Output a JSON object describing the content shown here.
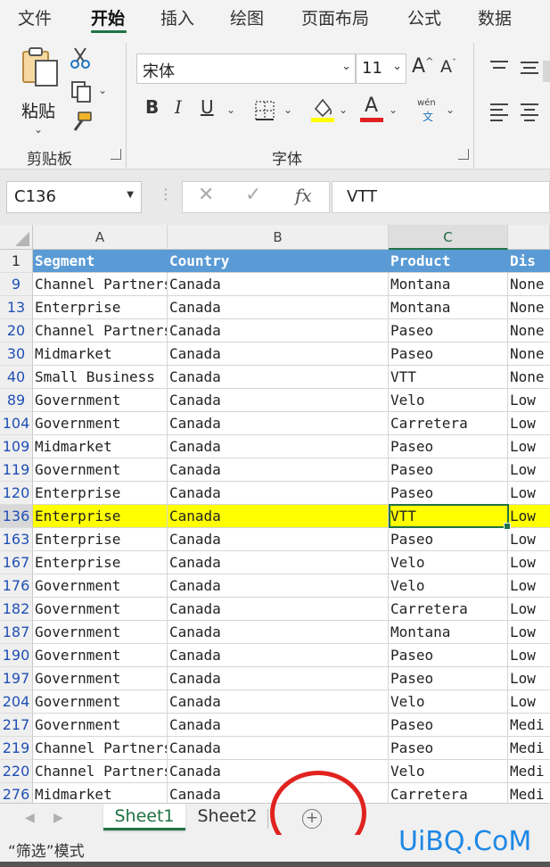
{
  "ribbon_tabs": [
    "文件",
    "开始",
    "插入",
    "绘图",
    "页面布局",
    "公式",
    "数据"
  ],
  "active_tab": "开始",
  "clipboard": {
    "paste_label": "粘贴",
    "group_label": "剪贴板"
  },
  "font": {
    "name": "宋体",
    "size": "11",
    "group_label": "字体",
    "phonetic_top": "wén",
    "phonetic_bottom": "文"
  },
  "font_colors": {
    "highlight": "#ffff00",
    "text": "#e02020"
  },
  "formula_bar": {
    "name_box": "C136",
    "fx": "fx",
    "content": "VTT"
  },
  "columns": [
    "A",
    "B",
    "C"
  ],
  "header_row": {
    "num": "1",
    "cells": [
      "Segment",
      "Country",
      "Product",
      "Dis"
    ]
  },
  "rows": [
    {
      "num": "9",
      "cells": [
        "Channel Partners",
        "Canada",
        "Montana",
        "None"
      ]
    },
    {
      "num": "13",
      "cells": [
        "Enterprise",
        "Canada",
        "Montana",
        "None"
      ]
    },
    {
      "num": "20",
      "cells": [
        "Channel Partners",
        "Canada",
        "Paseo",
        "None"
      ]
    },
    {
      "num": "30",
      "cells": [
        "Midmarket",
        "Canada",
        "Paseo",
        "None"
      ]
    },
    {
      "num": "40",
      "cells": [
        "Small Business",
        "Canada",
        "VTT",
        "None"
      ]
    },
    {
      "num": "89",
      "cells": [
        "Government",
        "Canada",
        "Velo",
        "Low"
      ]
    },
    {
      "num": "104",
      "cells": [
        "Government",
        "Canada",
        "Carretera",
        "Low"
      ]
    },
    {
      "num": "109",
      "cells": [
        "Midmarket",
        "Canada",
        "Paseo",
        "Low"
      ]
    },
    {
      "num": "119",
      "cells": [
        "Government",
        "Canada",
        "Paseo",
        "Low"
      ]
    },
    {
      "num": "120",
      "cells": [
        "Enterprise",
        "Canada",
        "Paseo",
        "Low"
      ]
    },
    {
      "num": "136",
      "cells": [
        "Enterprise",
        "Canada",
        "VTT",
        "Low"
      ],
      "highlight": true
    },
    {
      "num": "163",
      "cells": [
        "Enterprise",
        "Canada",
        "Paseo",
        "Low"
      ]
    },
    {
      "num": "167",
      "cells": [
        "Enterprise",
        "Canada",
        "Velo",
        "Low"
      ]
    },
    {
      "num": "176",
      "cells": [
        "Government",
        "Canada",
        "Velo",
        "Low"
      ]
    },
    {
      "num": "182",
      "cells": [
        "Government",
        "Canada",
        "Carretera",
        "Low"
      ]
    },
    {
      "num": "187",
      "cells": [
        "Government",
        "Canada",
        "Montana",
        "Low"
      ]
    },
    {
      "num": "190",
      "cells": [
        "Government",
        "Canada",
        "Paseo",
        "Low"
      ]
    },
    {
      "num": "197",
      "cells": [
        "Government",
        "Canada",
        "Paseo",
        "Low"
      ]
    },
    {
      "num": "204",
      "cells": [
        "Government",
        "Canada",
        "Velo",
        "Low"
      ]
    },
    {
      "num": "217",
      "cells": [
        "Government",
        "Canada",
        "Paseo",
        "Medi"
      ]
    },
    {
      "num": "219",
      "cells": [
        "Channel Partners",
        "Canada",
        "Paseo",
        "Medi"
      ]
    },
    {
      "num": "220",
      "cells": [
        "Channel Partners",
        "Canada",
        "Velo",
        "Medi"
      ]
    },
    {
      "num": "276",
      "cells": [
        "Midmarket",
        "Canada",
        "Carretera",
        "Medi"
      ]
    }
  ],
  "sheet_tabs": [
    "Sheet1",
    "Sheet2"
  ],
  "active_sheet": "Sheet1",
  "add_sheet_symbol": "+",
  "status_text": "“筛选”模式",
  "watermark": "UiBQ.CoM",
  "colors": {
    "header_fill": "#5b9bd5",
    "highlight_fill": "#ffff00",
    "accent": "#217346",
    "annotation": "#e0231f"
  }
}
